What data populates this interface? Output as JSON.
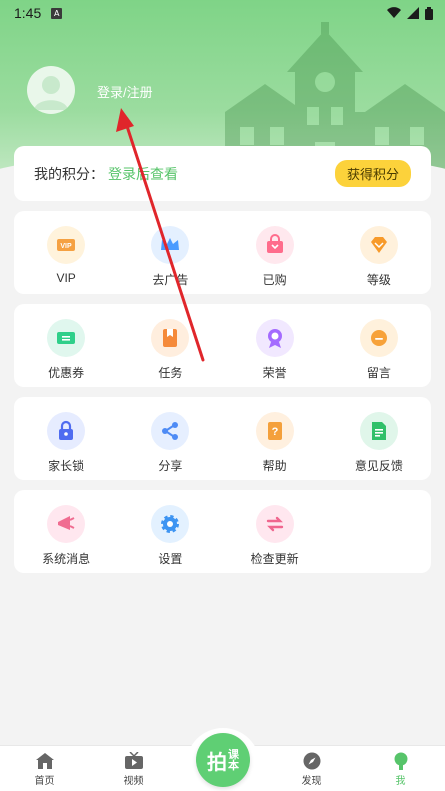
{
  "status_bar": {
    "time": "1:45",
    "app_badge": "A"
  },
  "header": {
    "login_text": "登录/注册"
  },
  "points": {
    "label": "我的积分：",
    "value": "登录后查看",
    "button": "获得积分"
  },
  "sections": [
    [
      {
        "label": "VIP",
        "icon": "vip-icon",
        "bg": "#fff3dc",
        "color": "#f5a142"
      },
      {
        "label": "去广告",
        "icon": "crown-icon",
        "bg": "#e4f0ff",
        "color": "#4a9bff"
      },
      {
        "label": "已购",
        "icon": "shopping-bag-icon",
        "bg": "#ffe8ee",
        "color": "#ff6c8c"
      },
      {
        "label": "等级",
        "icon": "diamond-icon",
        "bg": "#fff1dc",
        "color": "#f79a2a"
      }
    ],
    [
      {
        "label": "优惠券",
        "icon": "coupon-icon",
        "bg": "#e0f7ee",
        "color": "#2fcf8a"
      },
      {
        "label": "任务",
        "icon": "task-bookmark-icon",
        "bg": "#ffeede",
        "color": "#f58a3a"
      },
      {
        "label": "荣誉",
        "icon": "medal-icon",
        "bg": "#f1e8ff",
        "color": "#a46bff"
      },
      {
        "label": "留言",
        "icon": "message-icon",
        "bg": "#fff1dc",
        "color": "#f7a23a"
      }
    ],
    [
      {
        "label": "家长锁",
        "icon": "lock-icon",
        "bg": "#e6ecff",
        "color": "#4f6cf0"
      },
      {
        "label": "分享",
        "icon": "share-icon",
        "bg": "#e6efff",
        "color": "#4e8bf5"
      },
      {
        "label": "帮助",
        "icon": "help-book-icon",
        "bg": "#fff0df",
        "color": "#f4a03c"
      },
      {
        "label": "意见反馈",
        "icon": "feedback-icon",
        "bg": "#e0f6ea",
        "color": "#31c06a"
      }
    ],
    [
      {
        "label": "系统消息",
        "icon": "notification-icon",
        "bg": "#ffe7ef",
        "color": "#f06c91"
      },
      {
        "label": "设置",
        "icon": "gear-icon",
        "bg": "#e3f1ff",
        "color": "#3d94f2"
      },
      {
        "label": "检查更新",
        "icon": "update-arrows-icon",
        "bg": "#ffe7ef",
        "color": "#f0668e"
      }
    ]
  ],
  "nav": {
    "items": [
      {
        "label": "首页",
        "icon": "home-icon"
      },
      {
        "label": "视频",
        "icon": "tv-icon"
      },
      {
        "label": "发现",
        "icon": "compass-icon"
      },
      {
        "label": "我",
        "icon": "profile-icon"
      }
    ],
    "center_text": "拍",
    "center_text_small": "课",
    "center_text_small2": "本",
    "accent": "#57c46a"
  }
}
